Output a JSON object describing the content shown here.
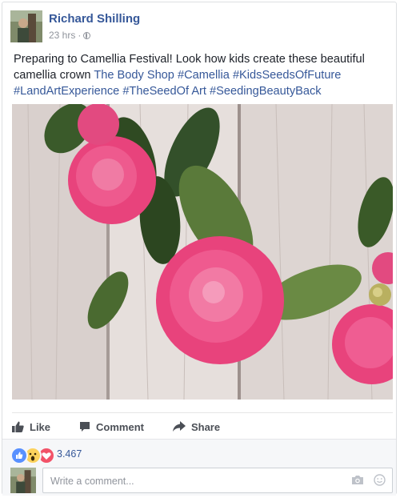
{
  "post": {
    "author": "Richard Shilling",
    "time": "23 hrs",
    "separator": "·",
    "text_plain": "Preparing to Camellia Festival! Look how kids create these beautiful camellia crown ",
    "links": [
      "The Body Shop",
      "#Camellia",
      "#KidsSeedsOfFuture",
      "#LandArtExperience",
      "#TheSeedOf Art",
      "#SeedingBeautyBack"
    ]
  },
  "actions": {
    "like_label": "Like",
    "comment_label": "Comment",
    "share_label": "Share"
  },
  "reactions": {
    "count": "3.467",
    "types": [
      "like-reaction",
      "wow-reaction",
      "love-reaction"
    ]
  },
  "comment_box": {
    "placeholder": "Write a comment..."
  },
  "colors": {
    "link": "#365899",
    "muted": "#90949c",
    "like_blue": "#5890ff",
    "love_red": "#f25268",
    "wow_yellow": "#fcd25c"
  }
}
